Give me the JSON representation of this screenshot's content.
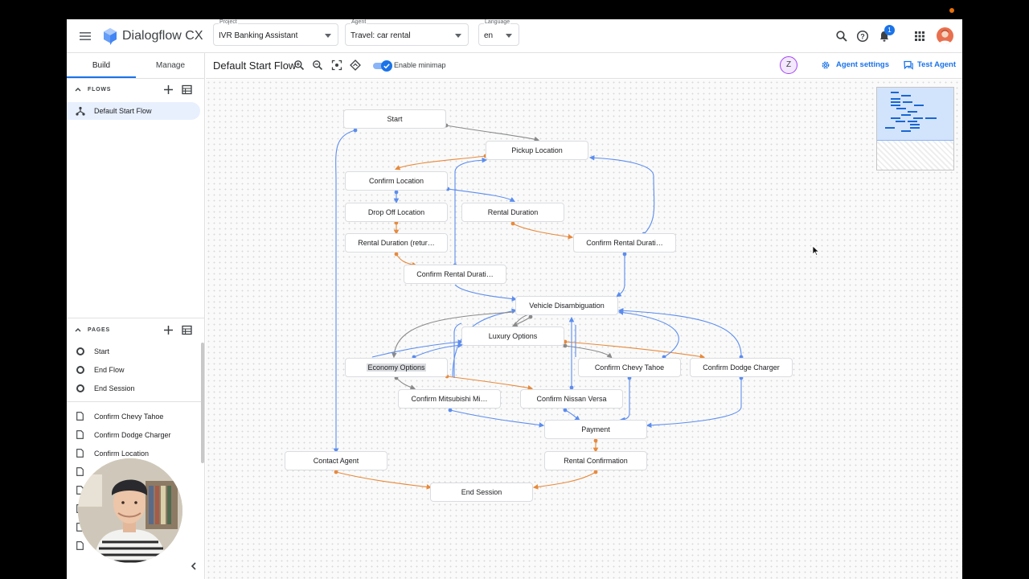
{
  "header": {
    "app_name": "Dialogflow CX",
    "project": {
      "label": "Project",
      "value": "IVR Banking Assistant"
    },
    "agent": {
      "label": "Agent",
      "value": "Travel: car rental"
    },
    "language": {
      "label": "Language",
      "value": "en"
    },
    "notification_count": "1",
    "icons": [
      "menu-icon",
      "dialogflow-logo",
      "search-icon",
      "help-icon",
      "notifications-icon",
      "apps-icon",
      "user-avatar"
    ]
  },
  "left_panel": {
    "tabs": [
      {
        "label": "Build",
        "active": true
      },
      {
        "label": "Manage",
        "active": false
      }
    ],
    "flows": {
      "title": "FLOWS",
      "items": [
        {
          "label": "Default Start Flow",
          "selected": true
        }
      ]
    },
    "pages": {
      "title": "PAGES",
      "special": [
        "Start",
        "End Flow",
        "End Session"
      ],
      "items": [
        "Confirm Chevy Tahoe",
        "Confirm Dodge Charger",
        "Confirm Location"
      ]
    }
  },
  "toolbar": {
    "flow_title": "Default Start Flow",
    "minimap_label": "Enable minimap",
    "minimap_enabled": true,
    "presence_initial": "Z",
    "agent_settings": "Agent settings",
    "test_agent": "Test Agent"
  },
  "graph": {
    "nodes": {
      "start": "Start",
      "pickup": "Pickup Location",
      "confirm_location": "Confirm Location",
      "dropoff": "Drop Off Location",
      "rental_duration": "Rental Duration",
      "rental_duration_return": "Rental Duration (retur…",
      "confirm_rental_duration_right": "Confirm Rental Durati…",
      "confirm_rental_duration_left": "Confirm Rental Durati…",
      "vehicle": "Vehicle Disambiguation",
      "luxury": "Luxury Options",
      "economy": "Economy Options",
      "chevy": "Confirm Chevy Tahoe",
      "dodge": "Confirm Dodge Charger",
      "mitsubishi": "Confirm Mitsubishi Mi…",
      "nissan": "Confirm Nissan Versa",
      "payment": "Payment",
      "contact": "Contact Agent",
      "rental_confirmation": "Rental Confirmation",
      "end_session": "End Session"
    },
    "edge_colors": {
      "route": "#5b8def",
      "event": "#e8893a",
      "default": "#8a8a8a"
    }
  }
}
